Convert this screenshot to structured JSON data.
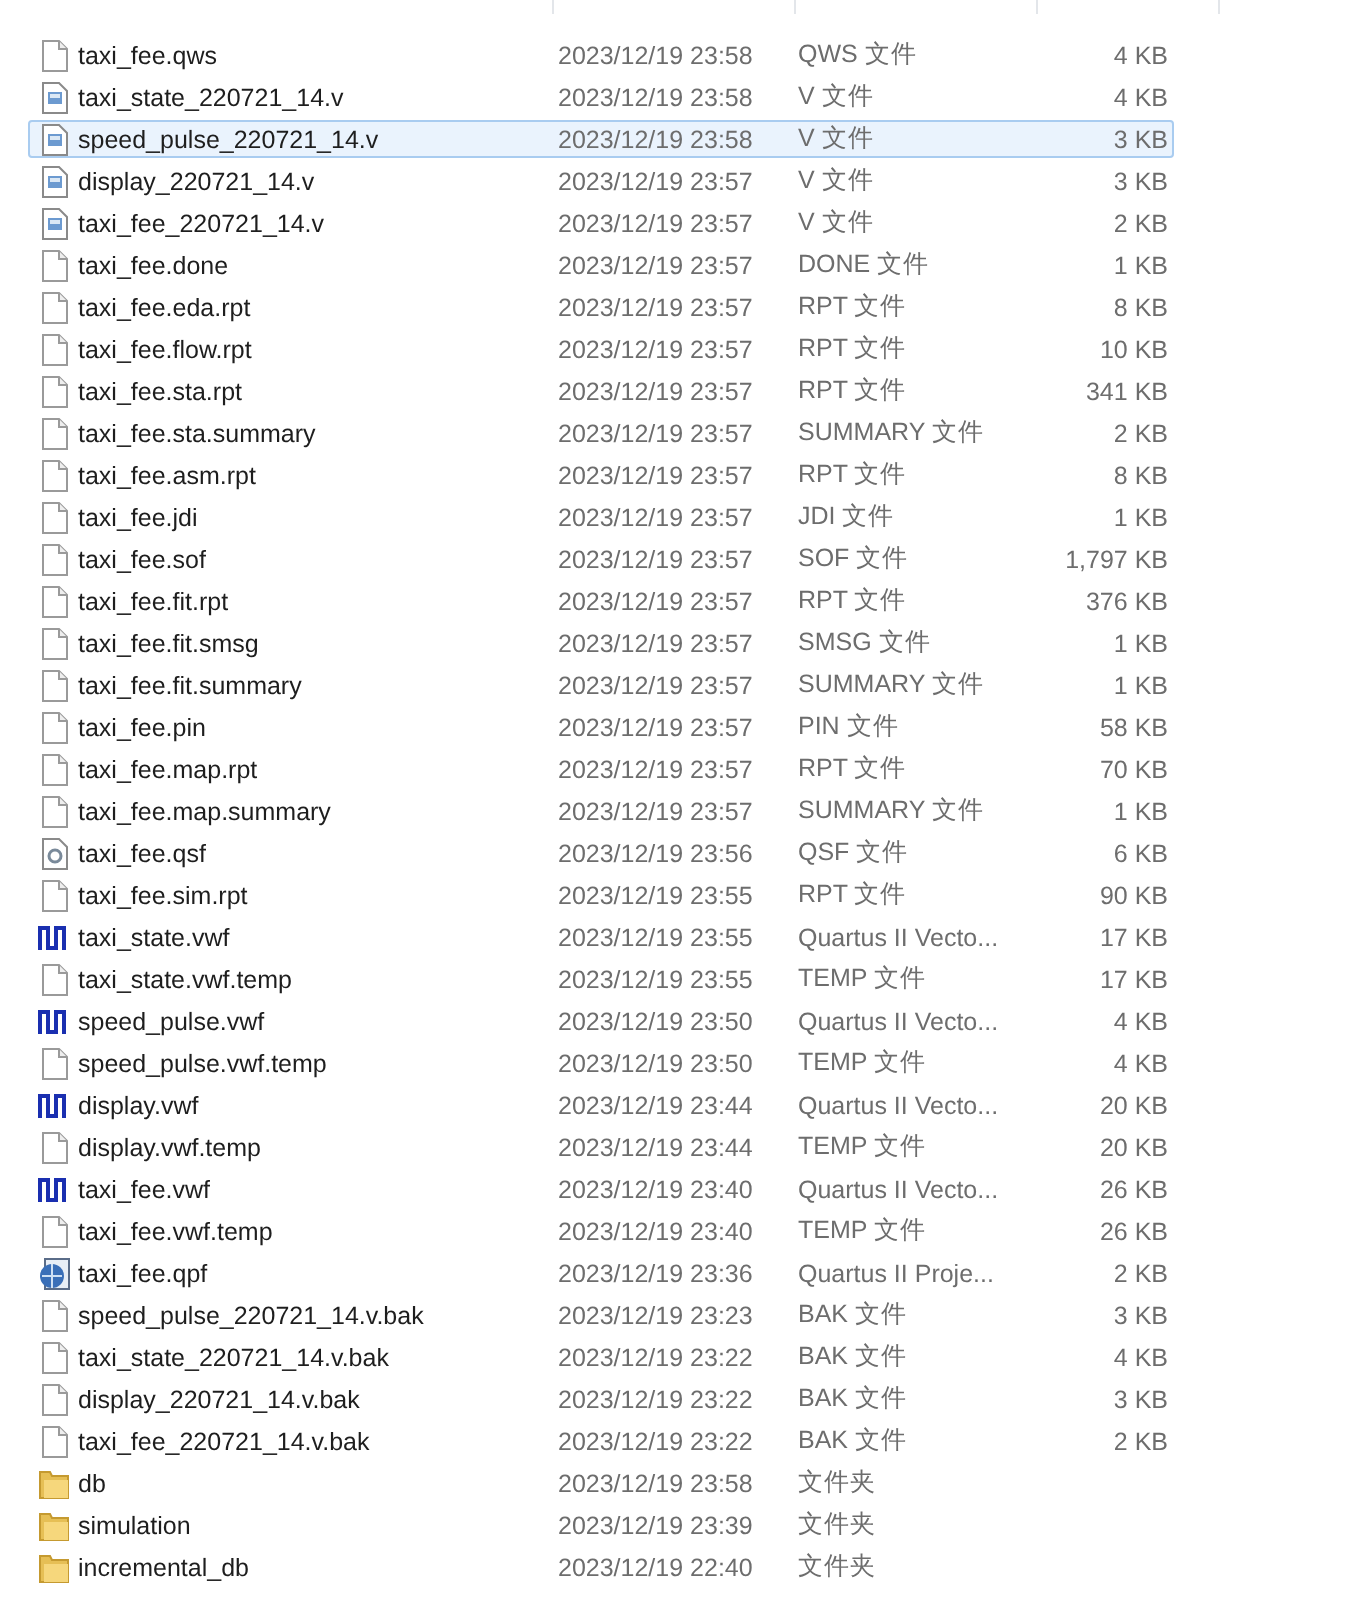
{
  "files": [
    {
      "kind": "file",
      "name": "taxi_fee.qws",
      "date": "2023/12/19 23:58",
      "type": "QWS 文件",
      "size": "4 KB",
      "selected": false
    },
    {
      "kind": "source",
      "name": "taxi_state_220721_14.v",
      "date": "2023/12/19 23:58",
      "type": "V 文件",
      "size": "4 KB",
      "selected": false
    },
    {
      "kind": "source",
      "name": "speed_pulse_220721_14.v",
      "date": "2023/12/19 23:58",
      "type": "V 文件",
      "size": "3 KB",
      "selected": true
    },
    {
      "kind": "source",
      "name": "display_220721_14.v",
      "date": "2023/12/19 23:57",
      "type": "V 文件",
      "size": "3 KB",
      "selected": false
    },
    {
      "kind": "source",
      "name": "taxi_fee_220721_14.v",
      "date": "2023/12/19 23:57",
      "type": "V 文件",
      "size": "2 KB",
      "selected": false
    },
    {
      "kind": "file",
      "name": "taxi_fee.done",
      "date": "2023/12/19 23:57",
      "type": "DONE 文件",
      "size": "1 KB",
      "selected": false
    },
    {
      "kind": "file",
      "name": "taxi_fee.eda.rpt",
      "date": "2023/12/19 23:57",
      "type": "RPT 文件",
      "size": "8 KB",
      "selected": false
    },
    {
      "kind": "file",
      "name": "taxi_fee.flow.rpt",
      "date": "2023/12/19 23:57",
      "type": "RPT 文件",
      "size": "10 KB",
      "selected": false
    },
    {
      "kind": "file",
      "name": "taxi_fee.sta.rpt",
      "date": "2023/12/19 23:57",
      "type": "RPT 文件",
      "size": "341 KB",
      "selected": false
    },
    {
      "kind": "file",
      "name": "taxi_fee.sta.summary",
      "date": "2023/12/19 23:57",
      "type": "SUMMARY 文件",
      "size": "2 KB",
      "selected": false
    },
    {
      "kind": "file",
      "name": "taxi_fee.asm.rpt",
      "date": "2023/12/19 23:57",
      "type": "RPT 文件",
      "size": "8 KB",
      "selected": false
    },
    {
      "kind": "file",
      "name": "taxi_fee.jdi",
      "date": "2023/12/19 23:57",
      "type": "JDI 文件",
      "size": "1 KB",
      "selected": false
    },
    {
      "kind": "file",
      "name": "taxi_fee.sof",
      "date": "2023/12/19 23:57",
      "type": "SOF 文件",
      "size": "1,797 KB",
      "selected": false
    },
    {
      "kind": "file",
      "name": "taxi_fee.fit.rpt",
      "date": "2023/12/19 23:57",
      "type": "RPT 文件",
      "size": "376 KB",
      "selected": false
    },
    {
      "kind": "file",
      "name": "taxi_fee.fit.smsg",
      "date": "2023/12/19 23:57",
      "type": "SMSG 文件",
      "size": "1 KB",
      "selected": false
    },
    {
      "kind": "file",
      "name": "taxi_fee.fit.summary",
      "date": "2023/12/19 23:57",
      "type": "SUMMARY 文件",
      "size": "1 KB",
      "selected": false
    },
    {
      "kind": "file",
      "name": "taxi_fee.pin",
      "date": "2023/12/19 23:57",
      "type": "PIN 文件",
      "size": "58 KB",
      "selected": false
    },
    {
      "kind": "file",
      "name": "taxi_fee.map.rpt",
      "date": "2023/12/19 23:57",
      "type": "RPT 文件",
      "size": "70 KB",
      "selected": false
    },
    {
      "kind": "file",
      "name": "taxi_fee.map.summary",
      "date": "2023/12/19 23:57",
      "type": "SUMMARY 文件",
      "size": "1 KB",
      "selected": false
    },
    {
      "kind": "settings",
      "name": "taxi_fee.qsf",
      "date": "2023/12/19 23:56",
      "type": "QSF 文件",
      "size": "6 KB",
      "selected": false
    },
    {
      "kind": "file",
      "name": "taxi_fee.sim.rpt",
      "date": "2023/12/19 23:55",
      "type": "RPT 文件",
      "size": "90 KB",
      "selected": false
    },
    {
      "kind": "waveform",
      "name": "taxi_state.vwf",
      "date": "2023/12/19 23:55",
      "type": "Quartus II Vecto...",
      "size": "17 KB",
      "selected": false
    },
    {
      "kind": "file",
      "name": "taxi_state.vwf.temp",
      "date": "2023/12/19 23:55",
      "type": "TEMP 文件",
      "size": "17 KB",
      "selected": false
    },
    {
      "kind": "waveform",
      "name": "speed_pulse.vwf",
      "date": "2023/12/19 23:50",
      "type": "Quartus II Vecto...",
      "size": "4 KB",
      "selected": false
    },
    {
      "kind": "file",
      "name": "speed_pulse.vwf.temp",
      "date": "2023/12/19 23:50",
      "type": "TEMP 文件",
      "size": "4 KB",
      "selected": false
    },
    {
      "kind": "waveform",
      "name": "display.vwf",
      "date": "2023/12/19 23:44",
      "type": "Quartus II Vecto...",
      "size": "20 KB",
      "selected": false
    },
    {
      "kind": "file",
      "name": "display.vwf.temp",
      "date": "2023/12/19 23:44",
      "type": "TEMP 文件",
      "size": "20 KB",
      "selected": false
    },
    {
      "kind": "waveform",
      "name": "taxi_fee.vwf",
      "date": "2023/12/19 23:40",
      "type": "Quartus II Vecto...",
      "size": "26 KB",
      "selected": false
    },
    {
      "kind": "file",
      "name": "taxi_fee.vwf.temp",
      "date": "2023/12/19 23:40",
      "type": "TEMP 文件",
      "size": "26 KB",
      "selected": false
    },
    {
      "kind": "project",
      "name": "taxi_fee.qpf",
      "date": "2023/12/19 23:36",
      "type": "Quartus II Proje...",
      "size": "2 KB",
      "selected": false
    },
    {
      "kind": "file",
      "name": "speed_pulse_220721_14.v.bak",
      "date": "2023/12/19 23:23",
      "type": "BAK 文件",
      "size": "3 KB",
      "selected": false
    },
    {
      "kind": "file",
      "name": "taxi_state_220721_14.v.bak",
      "date": "2023/12/19 23:22",
      "type": "BAK 文件",
      "size": "4 KB",
      "selected": false
    },
    {
      "kind": "file",
      "name": "display_220721_14.v.bak",
      "date": "2023/12/19 23:22",
      "type": "BAK 文件",
      "size": "3 KB",
      "selected": false
    },
    {
      "kind": "file",
      "name": "taxi_fee_220721_14.v.bak",
      "date": "2023/12/19 23:22",
      "type": "BAK 文件",
      "size": "2 KB",
      "selected": false
    },
    {
      "kind": "folder",
      "name": "db",
      "date": "2023/12/19 23:58",
      "type": "文件夹",
      "selected": false
    },
    {
      "kind": "folder",
      "name": "simulation",
      "date": "2023/12/19 23:39",
      "type": "文件夹",
      "selected": false
    },
    {
      "kind": "folder",
      "name": "incremental_db",
      "date": "2023/12/19 22:40",
      "type": "文件夹",
      "selected": false
    }
  ]
}
